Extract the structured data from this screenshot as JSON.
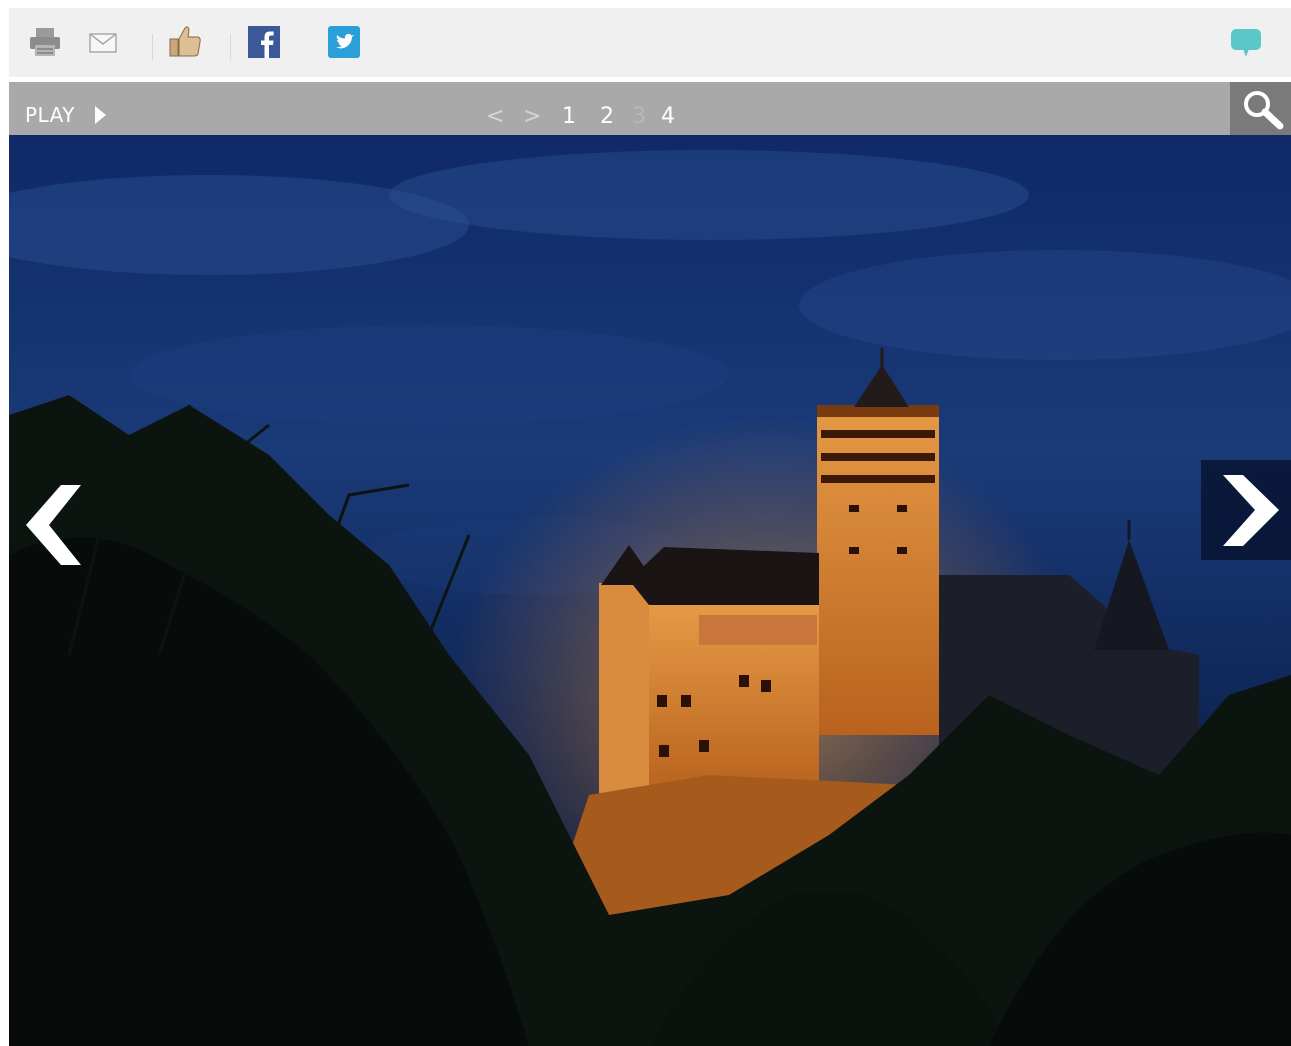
{
  "toolbar": {
    "icons": [
      "printer-icon",
      "mail-icon",
      "thumbs-up-icon",
      "facebook-icon",
      "twitter-icon",
      "comment-icon"
    ],
    "colors": {
      "background": "#f0f0f0",
      "facebook": "#3b5998",
      "twitter": "#2b9fd8",
      "comment": "#5ac8c8"
    }
  },
  "slideshow": {
    "play_label": "PLAY",
    "prev_label": "<",
    "next_label": ">",
    "pages": [
      "1",
      "2",
      "3",
      "4"
    ],
    "current_page": "3",
    "bar_color": "#a9a9a9"
  },
  "photo": {
    "subject": "illuminated castle at dusk",
    "sky_color": "#1a3a78"
  }
}
